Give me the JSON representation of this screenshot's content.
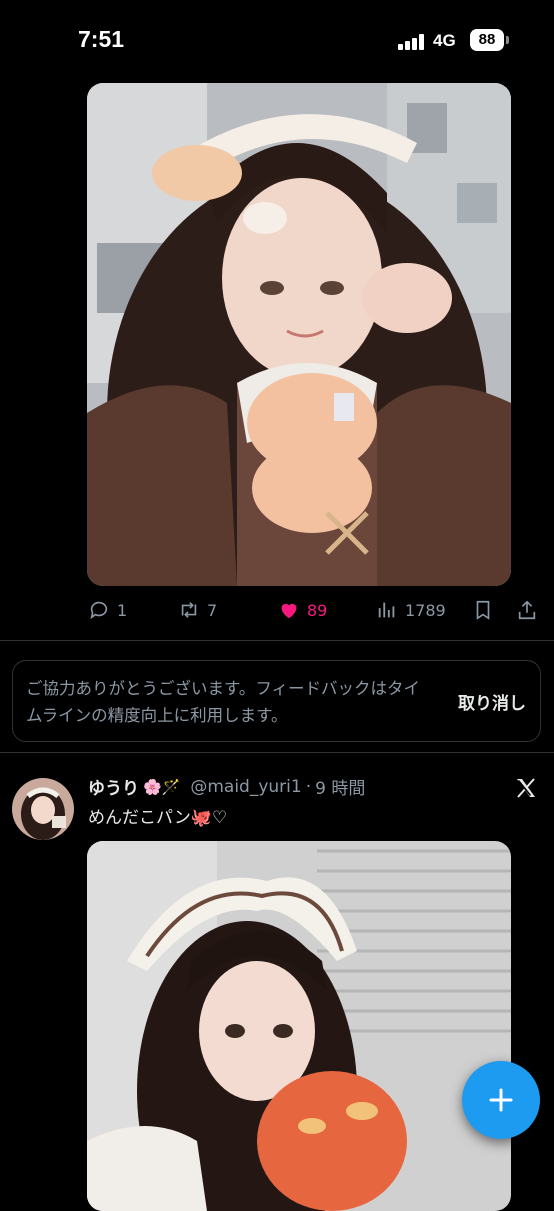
{
  "status_bar": {
    "time": "7:51",
    "network": "4G",
    "battery": "88"
  },
  "tweet1": {
    "image_alt": "maid selfie",
    "actions": {
      "replies": "1",
      "retweets": "7",
      "likes": "89",
      "views": "1789"
    }
  },
  "feedback": {
    "message": "ご協力ありがとうございます。フィードバックはタイムラインの精度向上に利用します。",
    "undo_label": "取り消し"
  },
  "tweet2": {
    "author_name": "ゆうり",
    "author_emoji": "🌸🪄",
    "handle": "@maid_yuri1",
    "separator": "·",
    "time": "9 時間",
    "text": "めんだこパン🐙♡"
  },
  "colors": {
    "accent": "#1d9bf0",
    "like": "#f91880",
    "muted": "#8b98a5",
    "border": "#2f3336"
  },
  "icons": [
    "reply-icon",
    "retweet-icon",
    "heart-icon",
    "views-icon",
    "bookmark-icon",
    "share-icon",
    "x-logo-icon",
    "plus-icon"
  ]
}
